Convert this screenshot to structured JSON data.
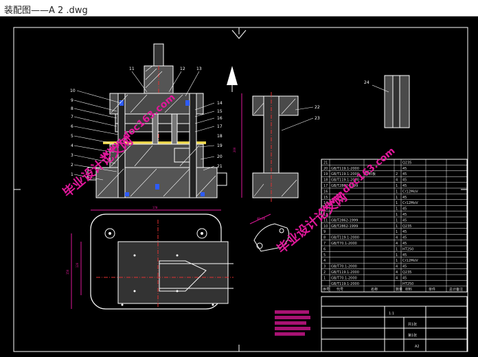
{
  "window": {
    "title": "装配图——A 2 .dwg"
  },
  "colors": {
    "background": "#000000",
    "line": "#ffffff",
    "hatch": "#ffffff",
    "part_fill": "#4a4a4a",
    "bolt": "#2d5bff",
    "dimension": "#e0189a",
    "center_line": "#e03030",
    "strip": "#e8d24a",
    "watermark": "#e0189a"
  },
  "drawing": {
    "main_section_callouts": [
      "10",
      "9",
      "8",
      "7",
      "6",
      "5",
      "4",
      "3",
      "2",
      "1",
      "11",
      "12",
      "13",
      "14",
      "15",
      "16",
      "17",
      "18",
      "19",
      "20",
      "21"
    ],
    "view2_callouts": [
      "22",
      "23"
    ],
    "view3_callouts": [
      "24"
    ],
    "dim_vertical_main": "200",
    "dim_top_plan": "170",
    "dim_left_outer": "150",
    "dim_left_inner": "120",
    "dim_strip": "40×20",
    "dim_small_top": "4",
    "notes_lines": [
      "1",
      "2",
      "3",
      "4",
      "5"
    ]
  },
  "bom": {
    "rows": [
      {
        "no": "21",
        "std": "",
        "name": "",
        "qty": "",
        "mat": "Q235"
      },
      {
        "no": "20",
        "std": "GB/T119.1-2000",
        "name": "",
        "qty": "",
        "mat": "45"
      },
      {
        "no": "19",
        "std": "GB/T119.1-2000",
        "name": "导料板",
        "qty": "2",
        "mat": "45"
      },
      {
        "no": "18",
        "std": "GB/T119.1-2000",
        "name": "",
        "qty": "4",
        "mat": "45"
      },
      {
        "no": "17",
        "std": "GB/T2862-1999",
        "name": "",
        "qty": "1",
        "mat": "45"
      },
      {
        "no": "16",
        "std": "",
        "name": "",
        "qty": "1",
        "mat": "Cr12MoV"
      },
      {
        "no": "15",
        "std": "",
        "name": "",
        "qty": "1",
        "mat": "45"
      },
      {
        "no": "14",
        "std": "",
        "name": "",
        "qty": "1",
        "mat": "Cr12MoV"
      },
      {
        "no": "13",
        "std": "",
        "name": "",
        "qty": "1",
        "mat": "45"
      },
      {
        "no": "12",
        "std": "",
        "name": "",
        "qty": "1",
        "mat": "45"
      },
      {
        "no": "11",
        "std": "GB/T2862-1999",
        "name": "",
        "qty": "1",
        "mat": "45"
      },
      {
        "no": "10",
        "std": "GB/T2862-1999",
        "name": "",
        "qty": "1",
        "mat": "Q235"
      },
      {
        "no": "9",
        "std": "",
        "name": "",
        "qty": "1",
        "mat": "45"
      },
      {
        "no": "8",
        "std": "GB/T119.1-2000",
        "name": "",
        "qty": "4",
        "mat": "45"
      },
      {
        "no": "7",
        "std": "GB/T70.1-2000",
        "name": "",
        "qty": "4",
        "mat": "45"
      },
      {
        "no": "6",
        "std": "",
        "name": "",
        "qty": "1",
        "mat": "HT250"
      },
      {
        "no": "5",
        "std": "",
        "name": "",
        "qty": "1",
        "mat": "45"
      },
      {
        "no": "4",
        "std": "",
        "name": "",
        "qty": "1",
        "mat": "Cr12MoV"
      },
      {
        "no": "3",
        "std": "GB/T70.1-2000",
        "name": "",
        "qty": "4",
        "mat": "45"
      },
      {
        "no": "2",
        "std": "GB/T119.1-2000",
        "name": "",
        "qty": "4",
        "mat": "Q235"
      },
      {
        "no": "1",
        "std": "GB/T70.1-2000",
        "name": "",
        "qty": "4",
        "mat": "45"
      },
      {
        "no": "",
        "std": "GB/T119.1-2000",
        "name": "",
        "qty": "",
        "mat": "HT250"
      }
    ],
    "header": [
      "序号",
      "代号",
      "名称",
      "数量",
      "材料",
      "单件",
      "总计",
      "备注"
    ]
  },
  "title_block": {
    "scale": "1:1",
    "sheet": "共1张",
    "sheet2": "第1张",
    "mark": "A2"
  },
  "watermarks": [
    "毕业设计论文网",
    "www.doc163.com"
  ]
}
